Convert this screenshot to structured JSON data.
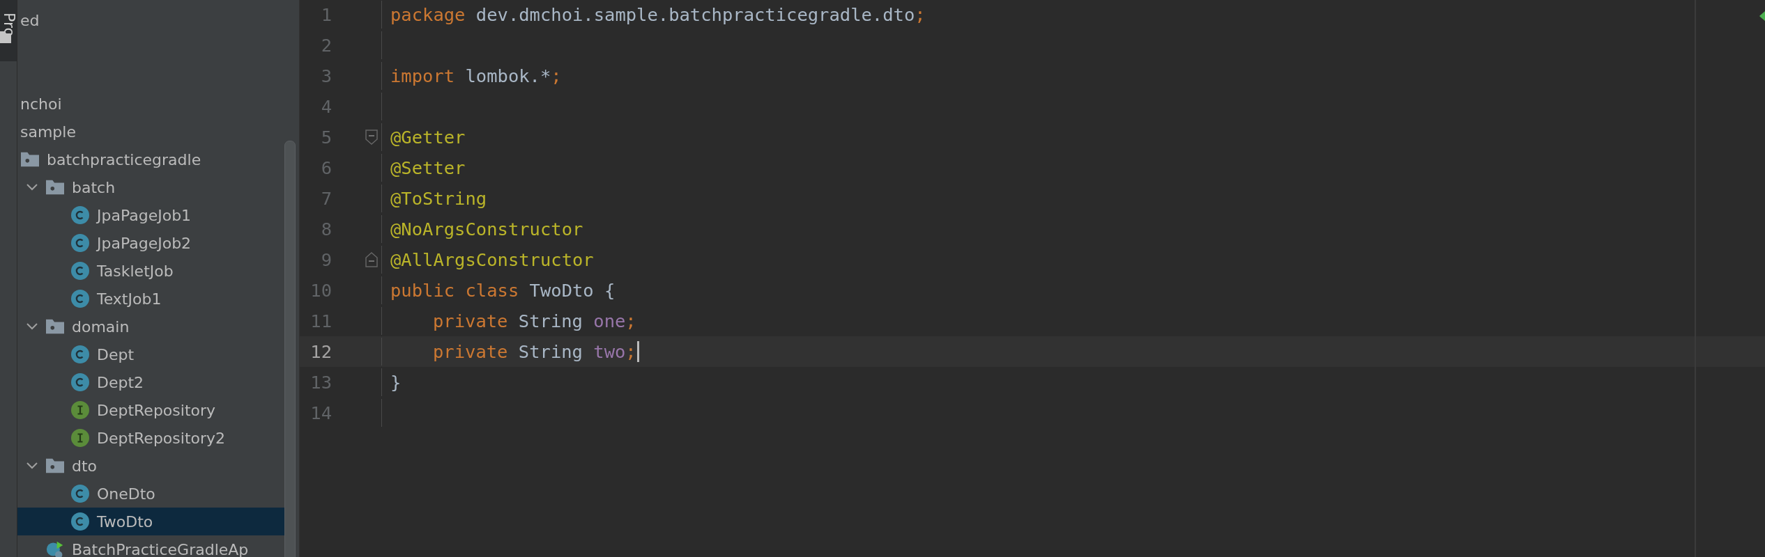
{
  "tool_strip": {
    "label": "Pro"
  },
  "project_tree": [
    {
      "label": "ed",
      "selected": false
    },
    {
      "label": "nchoi",
      "selected": false
    },
    {
      "label": "sample",
      "selected": false,
      "children": [
        {
          "label": "batchpracticegradle",
          "kind": "package",
          "selected": false,
          "children": [
            {
              "label": "batch",
              "kind": "package",
              "expanded": true,
              "selected": false,
              "children": [
                {
                  "label": "JpaPageJob1",
                  "kind": "class",
                  "selected": false
                },
                {
                  "label": "JpaPageJob2",
                  "kind": "class",
                  "selected": false
                },
                {
                  "label": "TaskletJob",
                  "kind": "class",
                  "selected": false
                },
                {
                  "label": "TextJob1",
                  "kind": "class",
                  "selected": false
                }
              ]
            },
            {
              "label": "domain",
              "kind": "package",
              "expanded": true,
              "selected": false,
              "children": [
                {
                  "label": "Dept",
                  "kind": "class",
                  "selected": false
                },
                {
                  "label": "Dept2",
                  "kind": "class",
                  "selected": false
                },
                {
                  "label": "DeptRepository",
                  "kind": "interface",
                  "selected": false
                },
                {
                  "label": "DeptRepository2",
                  "kind": "interface",
                  "selected": false
                }
              ]
            },
            {
              "label": "dto",
              "kind": "package",
              "expanded": true,
              "selected": false,
              "children": [
                {
                  "label": "OneDto",
                  "kind": "class",
                  "selected": false
                },
                {
                  "label": "TwoDto",
                  "kind": "class",
                  "selected": true
                }
              ]
            },
            {
              "label": "BatchPracticeGradleAp",
              "kind": "application",
              "selected": false
            }
          ]
        }
      ]
    }
  ],
  "editor": {
    "lines": [
      {
        "number": "1",
        "kind": "plain",
        "current": false,
        "tokens": [
          {
            "kind": "keyword",
            "text": "package "
          },
          {
            "kind": "plain",
            "text": "dev.dmchoi.sample.batchpracticegradle.dto"
          },
          {
            "kind": "keyword",
            "text": ";"
          }
        ]
      },
      {
        "number": "2",
        "kind": "plain",
        "current": false
      },
      {
        "number": "3",
        "kind": "plain",
        "current": false,
        "tokens": [
          {
            "kind": "keyword",
            "text": "import "
          },
          {
            "kind": "plain",
            "text": "lombok.*"
          },
          {
            "kind": "keyword",
            "text": ";"
          }
        ]
      },
      {
        "number": "4",
        "kind": "plain",
        "current": false
      },
      {
        "number": "5",
        "kind": "foldstart",
        "current": false,
        "tokens": [
          {
            "kind": "annotation",
            "text": "@Getter"
          }
        ]
      },
      {
        "number": "6",
        "kind": "plain",
        "current": false,
        "tokens": [
          {
            "kind": "annotation",
            "text": "@Setter"
          }
        ]
      },
      {
        "number": "7",
        "kind": "plain",
        "current": false,
        "tokens": [
          {
            "kind": "annotation",
            "text": "@ToString"
          }
        ]
      },
      {
        "number": "8",
        "kind": "plain",
        "current": false,
        "tokens": [
          {
            "kind": "annotation",
            "text": "@NoArgsConstructor"
          }
        ]
      },
      {
        "number": "9",
        "kind": "foldend",
        "current": false,
        "tokens": [
          {
            "kind": "annotation",
            "text": "@AllArgsConstructor"
          }
        ]
      },
      {
        "number": "10",
        "kind": "plain",
        "current": false,
        "tokens": [
          {
            "kind": "keyword",
            "text": "public class "
          },
          {
            "kind": "plain",
            "text": "TwoDto {"
          }
        ]
      },
      {
        "number": "11",
        "kind": "member",
        "current": false,
        "tokens": [
          {
            "kind": "keyword",
            "text": "private "
          },
          {
            "kind": "plain",
            "text": "String "
          },
          {
            "kind": "field",
            "text": "one"
          },
          {
            "kind": "keyword",
            "text": ";"
          }
        ]
      },
      {
        "number": "12",
        "kind": "member",
        "current": true,
        "tokens": [
          {
            "kind": "keyword",
            "text": "private "
          },
          {
            "kind": "plain",
            "text": "String "
          },
          {
            "kind": "field",
            "text": "two"
          },
          {
            "kind": "keyword",
            "text": ";"
          }
        ]
      },
      {
        "number": "13",
        "kind": "plain",
        "current": false,
        "tokens": [
          {
            "kind": "plain",
            "text": "}"
          }
        ]
      },
      {
        "number": "14",
        "kind": "plain",
        "current": false
      }
    ]
  }
}
